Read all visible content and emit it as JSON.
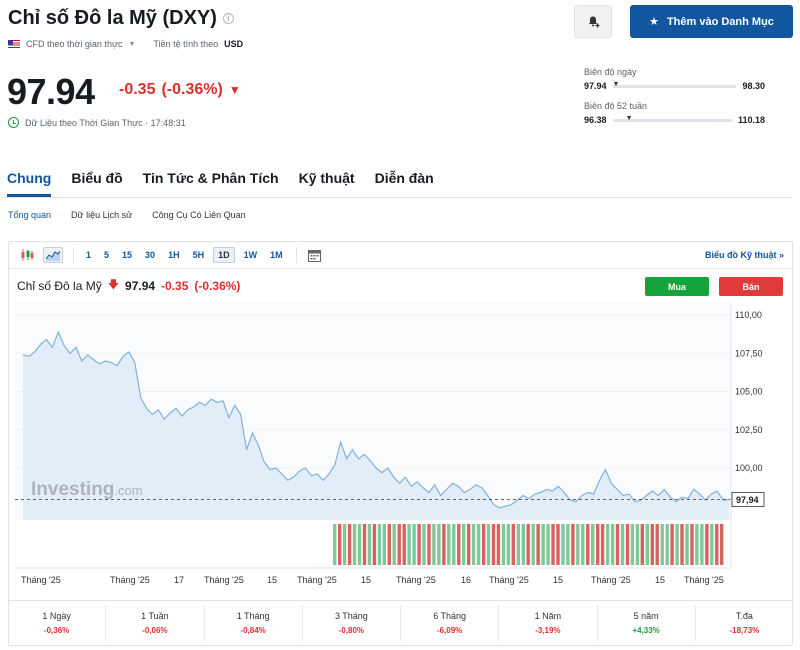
{
  "header": {
    "title": "Chỉ số Đô la Mỹ (DXY)",
    "sub_type": "CFD theo thời gian thực",
    "currency_label": "Tiền tệ tính theo",
    "currency_value": "USD",
    "watchlist_label": "Thêm vào Danh Mục"
  },
  "quote": {
    "price": "97.94",
    "change": "-0.35",
    "change_pct": "(-0.36%)",
    "realtime_label": "Dữ Liệu theo Thời Gian Thực · 17:48:31"
  },
  "ranges": [
    {
      "label": "Biên độ ngày",
      "low": "97.94",
      "high": "98.30",
      "position": 0.0
    },
    {
      "label": "Biên độ 52 tuần",
      "low": "96.38",
      "high": "110.18",
      "position": 0.11
    }
  ],
  "main_tabs": [
    {
      "label": "Chung",
      "active": true
    },
    {
      "label": "Biểu đồ",
      "active": false
    },
    {
      "label": "Tin Tức & Phân Tích",
      "active": false
    },
    {
      "label": "Kỹ thuật",
      "active": false
    },
    {
      "label": "Diễn đàn",
      "active": false
    }
  ],
  "sub_tabs": [
    {
      "label": "Tổng quan",
      "active": true
    },
    {
      "label": "Dữ liệu Lịch sử",
      "active": false
    },
    {
      "label": "Công Cụ Có Liên Quan",
      "active": false
    }
  ],
  "toolbar": {
    "timeframes": [
      {
        "label": "1",
        "active": false
      },
      {
        "label": "5",
        "active": false
      },
      {
        "label": "15",
        "active": false
      },
      {
        "label": "30",
        "active": false
      },
      {
        "label": "1H",
        "active": false
      },
      {
        "label": "5H",
        "active": false
      },
      {
        "label": "1D",
        "active": true
      },
      {
        "label": "1W",
        "active": false
      },
      {
        "label": "1M",
        "active": false
      }
    ],
    "tech_link": "Biểu đồ Kỹ thuật »"
  },
  "chart_legend": {
    "name": "Chỉ số Đô la Mỹ",
    "price": "97.94",
    "change": "-0.35",
    "change_pct": "(-0.36%)",
    "buy_label": "Mua",
    "sell_label": "Bán"
  },
  "chart_data": {
    "type": "area",
    "watermark": "Investing.com",
    "y_ticks": [
      "110,00",
      "107,50",
      "105,00",
      "102,50",
      "100,00"
    ],
    "y_tick_values": [
      110,
      107.5,
      105,
      102.5,
      100
    ],
    "ylim": [
      96.6,
      110.6
    ],
    "current_value": 97.94,
    "current_label": "97,94",
    "x_ticks": [
      "Tháng '25",
      "Tháng '25",
      "17",
      "Tháng '25",
      "15",
      "Tháng '25",
      "15",
      "Tháng '25",
      "16",
      "Tháng '25",
      "15",
      "Tháng '25",
      "15",
      "Tháng '25"
    ],
    "colors": {
      "line": "#7fb3dc",
      "fill": "#e3edf8",
      "up": "#7fc899",
      "down": "#d9615e"
    },
    "values": [
      107.4,
      107.3,
      107.6,
      108.1,
      108.4,
      107.9,
      108.9,
      108.0,
      107.5,
      107.9,
      107.0,
      107.4,
      107.1,
      106.8,
      107.0,
      106.9,
      106.7,
      107.3,
      107.6,
      106.9,
      104.6,
      103.9,
      103.5,
      103.8,
      103.2,
      103.6,
      103.9,
      103.4,
      103.8,
      104.0,
      104.3,
      104.1,
      104.5,
      104.3,
      104.4,
      103.3,
      104.1,
      103.5,
      101.2,
      102.3,
      101.5,
      100.4,
      99.9,
      100.0,
      99.6,
      99.2,
      99.4,
      99.8,
      100.0,
      99.5,
      99.6,
      99.2,
      99.6,
      100.2,
      101.7,
      100.6,
      101.2,
      100.6,
      100.9,
      100.5,
      100.0,
      99.7,
      100.0,
      99.4,
      99.0,
      99.4,
      98.8,
      99.1,
      98.7,
      98.4,
      98.9,
      98.2,
      98.6,
      99.0,
      98.8,
      98.4,
      98.6,
      98.9,
      98.7,
      98.2,
      97.6,
      97.4,
      97.5,
      97.6,
      97.9,
      98.2,
      98.0,
      98.3,
      98.4,
      98.6,
      98.5,
      98.8,
      98.4,
      97.9,
      97.8,
      98.2,
      98.4,
      98.3,
      99.2,
      99.9,
      99.0,
      98.6,
      98.2,
      98.3,
      97.8,
      97.9,
      98.2,
      98.5,
      98.2,
      98.6,
      98.1,
      97.8,
      98.1,
      98.0,
      98.6,
      98.3,
      97.9,
      98.3,
      98.5,
      97.9,
      97.94
    ],
    "volume_bars": [
      1,
      0,
      1,
      0,
      1,
      1,
      0,
      1,
      0,
      1,
      1,
      0,
      1,
      0,
      0,
      1,
      1,
      0,
      1,
      0,
      1,
      1,
      0,
      1,
      1,
      0,
      1,
      0,
      1,
      1,
      0,
      1,
      0,
      0,
      1,
      1,
      0,
      1,
      1,
      0,
      1,
      0,
      1,
      1,
      0,
      0,
      1,
      1,
      0,
      1,
      1,
      0,
      1,
      0,
      0,
      1,
      1,
      0,
      1,
      0,
      1,
      1,
      0,
      1,
      0,
      0,
      1,
      1,
      0,
      1,
      0,
      1,
      0,
      1,
      1,
      0,
      1,
      0,
      0
    ]
  },
  "performance": [
    {
      "label": "1 Ngày",
      "value": "-0,36%",
      "dir": "neg"
    },
    {
      "label": "1 Tuần",
      "value": "-0,06%",
      "dir": "neg"
    },
    {
      "label": "1 Tháng",
      "value": "-0,84%",
      "dir": "neg"
    },
    {
      "label": "3 Tháng",
      "value": "-0,80%",
      "dir": "neg"
    },
    {
      "label": "6 Tháng",
      "value": "-6,09%",
      "dir": "neg"
    },
    {
      "label": "1 Năm",
      "value": "-3,19%",
      "dir": "neg"
    },
    {
      "label": "5 năm",
      "value": "+4,33%",
      "dir": "pos"
    },
    {
      "label": "T.đa",
      "value": "-18,73%",
      "dir": "neg"
    }
  ]
}
